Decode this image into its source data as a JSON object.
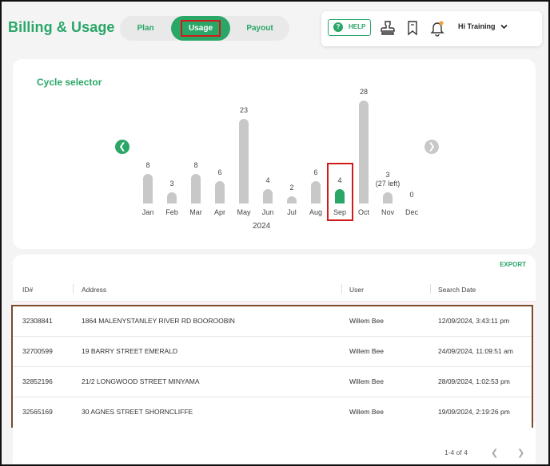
{
  "header": {
    "title": "Billing & Usage",
    "tabs": [
      {
        "label": "Plan",
        "active": false
      },
      {
        "label": "Usage",
        "active": true
      },
      {
        "label": "Payout",
        "active": false
      }
    ],
    "help_label": "HELP",
    "user_greeting": "Hi Training"
  },
  "cycle": {
    "title": "Cycle selector",
    "year": "2024",
    "selected_month": "Sep",
    "months": [
      {
        "label": "Jan",
        "value": 8,
        "display": "8"
      },
      {
        "label": "Feb",
        "value": 3,
        "display": "3"
      },
      {
        "label": "Mar",
        "value": 8,
        "display": "8"
      },
      {
        "label": "Apr",
        "value": 6,
        "display": "6"
      },
      {
        "label": "May",
        "value": 23,
        "display": "23"
      },
      {
        "label": "Jun",
        "value": 4,
        "display": "4"
      },
      {
        "label": "Jul",
        "value": 2,
        "display": "2"
      },
      {
        "label": "Aug",
        "value": 6,
        "display": "6"
      },
      {
        "label": "Sep",
        "value": 4,
        "display": "4"
      },
      {
        "label": "Oct",
        "value": 28,
        "display": "28"
      },
      {
        "label": "Nov",
        "value": 3,
        "display": "3",
        "note": "(27 left)"
      },
      {
        "label": "Dec",
        "value": 0,
        "display": "0"
      }
    ]
  },
  "table": {
    "export_label": "EXPORT",
    "columns": [
      "ID#",
      "Address",
      "User",
      "Search Date"
    ],
    "rows": [
      {
        "id": "32308841",
        "address": "1864 MALENYSTANLEY RIVER RD BOOROOBIN",
        "user": "Willem Bee",
        "date": "12/09/2024, 3:43:11 pm"
      },
      {
        "id": "32700599",
        "address": "19 BARRY STREET EMERALD",
        "user": "Willem Bee",
        "date": "24/09/2024, 11:09:51 am"
      },
      {
        "id": "32852196",
        "address": "21/2 LONGWOOD STREET MINYAMA",
        "user": "Willem Bee",
        "date": "28/09/2024, 1:02:53 pm"
      },
      {
        "id": "32565169",
        "address": "30 AGNES STREET SHORNCLIFFE",
        "user": "Willem Bee",
        "date": "19/09/2024, 2:19:26 pm"
      }
    ],
    "pagination": "1-4 of 4"
  },
  "colors": {
    "brand_green": "#2aa667",
    "bar_gray": "#c8c8c8",
    "highlight_red": "#d11a1a",
    "highlight_brown": "#7a4a2e"
  }
}
